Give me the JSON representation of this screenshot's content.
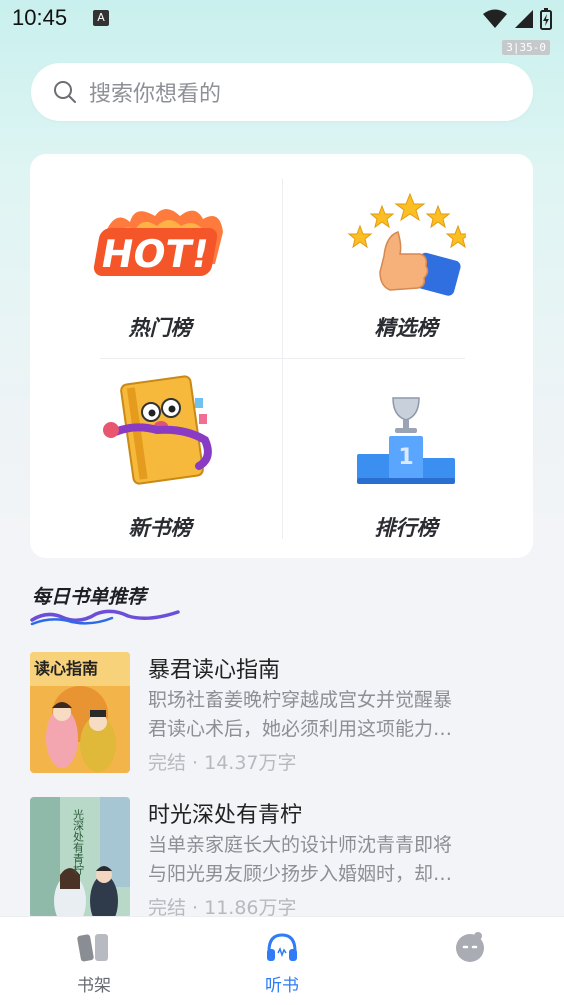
{
  "status": {
    "time": "10:45",
    "badge": "A",
    "page_indicator": "3|35-0"
  },
  "search": {
    "placeholder": "搜索你想看的"
  },
  "rankings": [
    {
      "label": "热门榜",
      "icon": "hot-icon"
    },
    {
      "label": "精选榜",
      "icon": "thumbs-up-stars-icon"
    },
    {
      "label": "新书榜",
      "icon": "book-mascot-icon"
    },
    {
      "label": "排行榜",
      "icon": "podium-icon"
    }
  ],
  "section": {
    "title": "每日书单推荐"
  },
  "books": [
    {
      "cover_title": "读心指南",
      "title": "暴君读心指南",
      "desc_line1": "职场社畜姜晚柠穿越成宫女并觉醒暴",
      "desc_line2": "君读心术后，她必须利用这项能力…",
      "meta": "完结 · 14.37万字"
    },
    {
      "cover_title": "光深处有青柠",
      "title": "时光深处有青柠",
      "desc_line1": "当单亲家庭长大的设计师沈青青即将",
      "desc_line2": "与阳光男友顾少扬步入婚姻时，却…",
      "meta": "完结 · 11.86万字"
    }
  ],
  "nav": [
    {
      "label": "书架",
      "icon": "bookshelf-icon"
    },
    {
      "label": "听书",
      "icon": "headphones-icon",
      "active": true
    },
    {
      "label": "",
      "icon": "profile-face-icon"
    }
  ],
  "colors": {
    "accent": "#2f7cf6",
    "hot_orange": "#f4562a",
    "podium_blue": "#3a8ff0"
  }
}
